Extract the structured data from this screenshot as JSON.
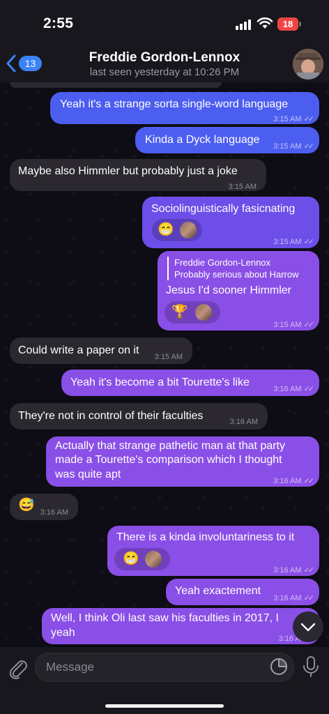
{
  "status_bar": {
    "time": "2:55",
    "battery": "18"
  },
  "header": {
    "back_count": "13",
    "contact_name": "Freddie Gordon-Lennox",
    "last_seen": "last seen yesterday at 10:26 PM"
  },
  "messages": [
    {
      "text": "Yeah it's a strange sorta single-word language",
      "time": "3:15 AM"
    },
    {
      "text": "Kinda a Dyck language",
      "time": "3:15 AM"
    },
    {
      "text": "Maybe also Himmler but probably just a joke",
      "time": "3:15 AM"
    },
    {
      "text": "Sociolinguistically fasicnating",
      "time": "3:15 AM",
      "reaction": "😁"
    },
    {
      "reply_name": "Freddie Gordon-Lennox",
      "reply_text": "Probably serious about Harrow",
      "text": "Jesus I'd sooner Himmler",
      "time": "3:15 AM",
      "reaction": "🏆"
    },
    {
      "text": "Could write a paper on it",
      "time": "3:15 AM"
    },
    {
      "text": "Yeah it's become a bit Tourette's like",
      "time": "3:16 AM"
    },
    {
      "text": "They're not in control of their faculties",
      "time": "3:16 AM"
    },
    {
      "lines": [
        "Actually that strange pathetic man at that party",
        "made a Tourette's comparison which I thought",
        "was quite apt"
      ],
      "time": "3:16 AM"
    },
    {
      "text": "😅",
      "time": "3:16 AM"
    },
    {
      "text": "There is a kinda involuntariness to it",
      "time": "3:16 AM",
      "reaction": "😁"
    },
    {
      "text": "Yeah exactement",
      "time": "3:16 AM"
    },
    {
      "lines": [
        "Well, I think Oli last saw his faculties in 2017, I",
        "yeah"
      ],
      "time": "3:16 AM"
    }
  ],
  "input": {
    "placeholder": "Message"
  },
  "icons": {
    "back": "chevron-left-icon",
    "attach": "paperclip-icon",
    "sticker": "sticker-icon",
    "mic": "microphone-icon",
    "scroll": "chevron-down-icon",
    "read": "double-check-icon"
  },
  "colors": {
    "accent": "#3b82f6",
    "bubble_blue": "#4c5ef0",
    "bubble_violet": "#6d4ee8",
    "bubble_purple": "#8a4fe6",
    "bubble_incoming": "#2b2830",
    "battery": "#ef4444"
  }
}
